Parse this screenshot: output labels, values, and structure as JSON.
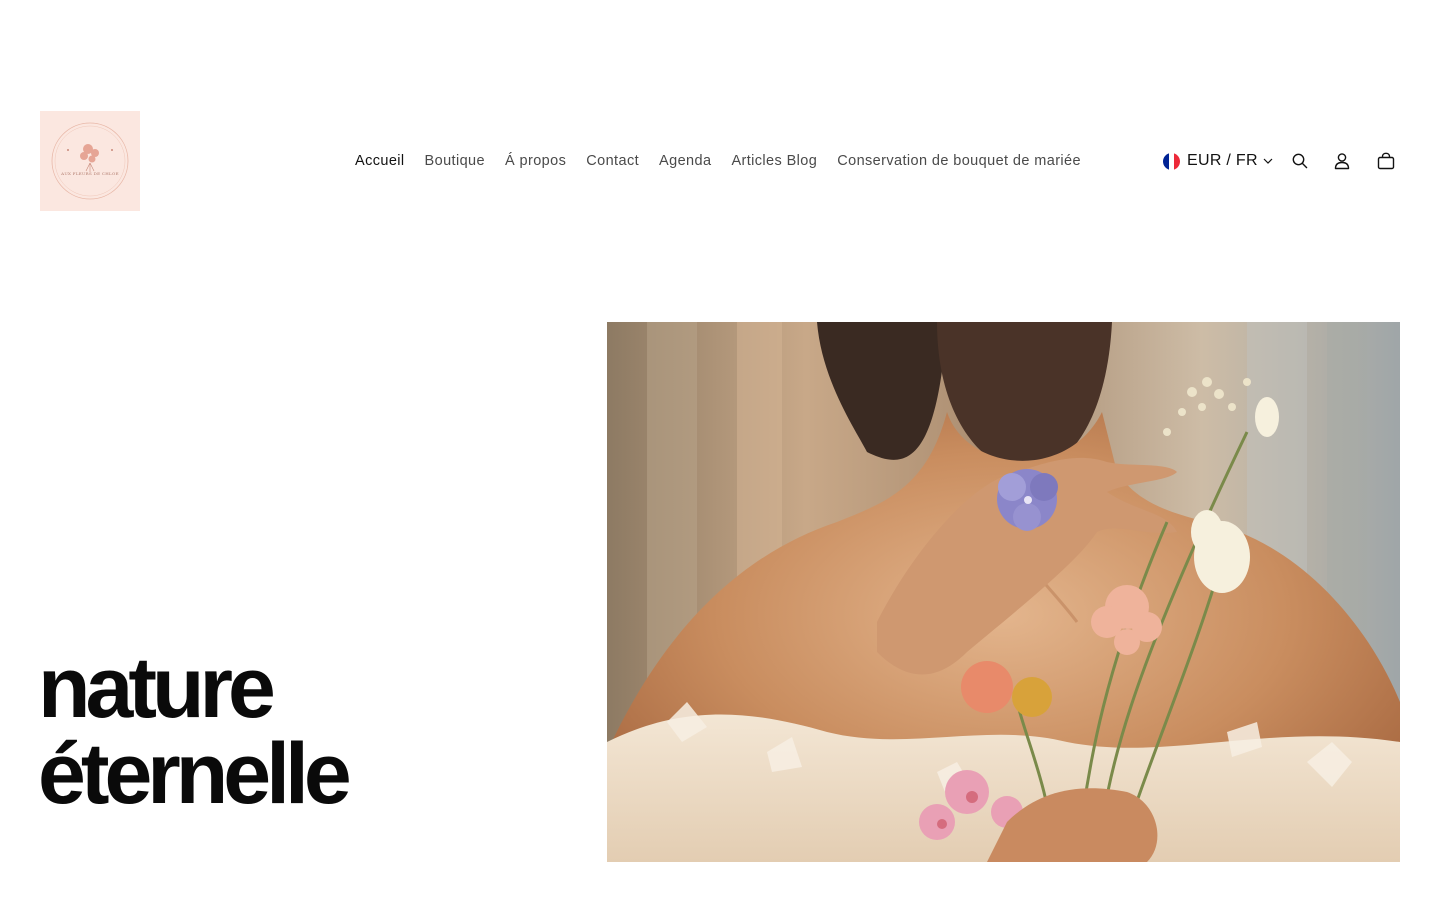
{
  "brand": {
    "logo_text": "AUX FLEURS DE CHLOE",
    "logo_bg": "#fbe7e0"
  },
  "nav": {
    "items": [
      {
        "label": "Accueil",
        "active": true
      },
      {
        "label": "Boutique"
      },
      {
        "label": "Á propos"
      },
      {
        "label": "Contact"
      },
      {
        "label": "Agenda"
      },
      {
        "label": "Articles Blog"
      },
      {
        "label": "Conservation de bouquet de mariée"
      }
    ]
  },
  "locale": {
    "label": "EUR / FR",
    "flag": "france-flag-icon"
  },
  "header_icons": [
    "search-icon",
    "account-icon",
    "cart-icon"
  ],
  "hero": {
    "title_line1": "nature",
    "title_line2": "éternelle",
    "image_alt": "Mariée tenant un bouquet de fleurs séchées"
  },
  "colors": {
    "text": "#121212",
    "nav_text": "#4a4a4a",
    "background": "#ffffff"
  }
}
